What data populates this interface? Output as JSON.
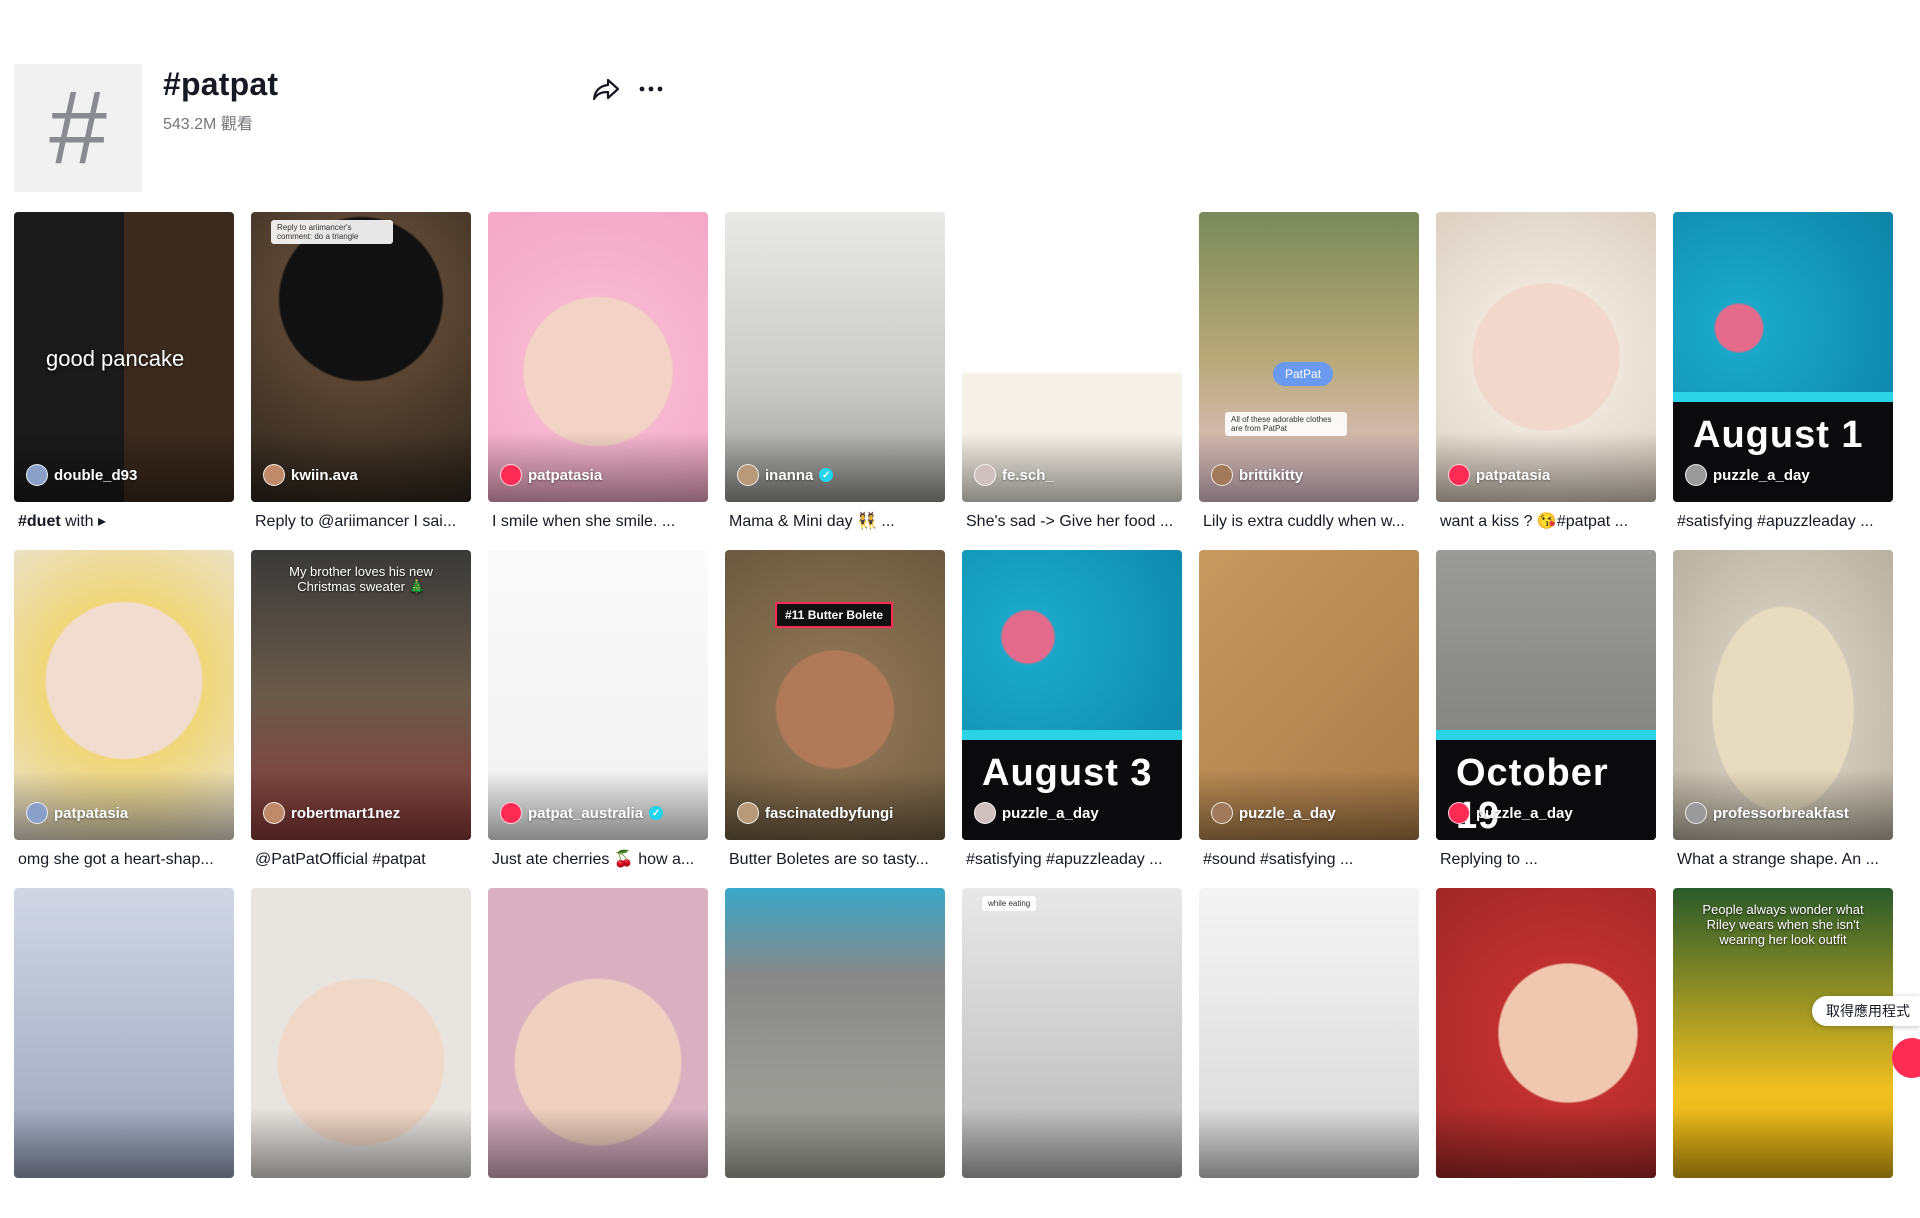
{
  "header": {
    "icon": "hashtag-icon",
    "title": "#patpat",
    "views": "543.2M 觀看"
  },
  "app_prompt": {
    "label": "取得應用程式"
  },
  "colors": {
    "accent": "#fe2c55",
    "verified": "#20d5ec",
    "date_band_stripe": "#2ad4e6"
  },
  "videos": [
    {
      "user": "double_d93",
      "caption_bold": "#duet",
      "caption": "with ▸",
      "overlay": "good pancake"
    },
    {
      "user": "kwiin.ava",
      "caption": "Reply to @ariimancer I sai...",
      "overlay_small": "Reply to ariimancer's comment: do a triangle"
    },
    {
      "user": "patpatasia",
      "caption": "I smile when she smile. ..."
    },
    {
      "user": "inanna",
      "verified": true,
      "caption": "Mama & Mini day 👯 ..."
    },
    {
      "user": "fe.sch_",
      "caption": "She's sad -> Give her food ..."
    },
    {
      "user": "brittikitty",
      "caption": "Lily is extra cuddly when w...",
      "overlay_badge": "PatPat",
      "overlay_small": "All of these adorable clothes are from PatPat"
    },
    {
      "user": "patpatasia",
      "caption": "want a kiss ? 😘#patpat ..."
    },
    {
      "user": "puzzle_a_day",
      "caption": "#satisfying #apuzzleaday ...",
      "date": "August 1"
    },
    {
      "user": "patpatasia",
      "caption": "omg she got a heart-shap..."
    },
    {
      "user": "robertmart1nez",
      "caption": "@PatPatOfficial #patpat",
      "overlay_text": "My brother loves his new Christmas sweater 🎄"
    },
    {
      "user": "patpat_australia",
      "verified": true,
      "caption": "Just ate cherries 🍒 how a..."
    },
    {
      "user": "fascinatedbyfungi",
      "caption": "Butter Boletes are so tasty...",
      "overlay_label": "#11 Butter Bolete"
    },
    {
      "user": "puzzle_a_day",
      "caption": "#satisfying #apuzzleaday ...",
      "date": "August 3"
    },
    {
      "user": "puzzle_a_day",
      "caption": "#sound #satisfying ..."
    },
    {
      "user": "puzzle_a_day",
      "caption": "Replying to ...",
      "date": "October 19"
    },
    {
      "user": "professorbreakfast",
      "caption": "What a strange shape. An ..."
    },
    {
      "user": "",
      "caption": ""
    },
    {
      "user": "",
      "caption": ""
    },
    {
      "user": "",
      "caption": ""
    },
    {
      "user": "",
      "caption": ""
    },
    {
      "user": "",
      "caption": "",
      "overlay_small": "while eating"
    },
    {
      "user": "",
      "caption": ""
    },
    {
      "user": "",
      "caption": ""
    },
    {
      "user": "",
      "caption": "",
      "overlay_text": "People always wonder what Riley wears when she isn't wearing her look outfit"
    }
  ]
}
